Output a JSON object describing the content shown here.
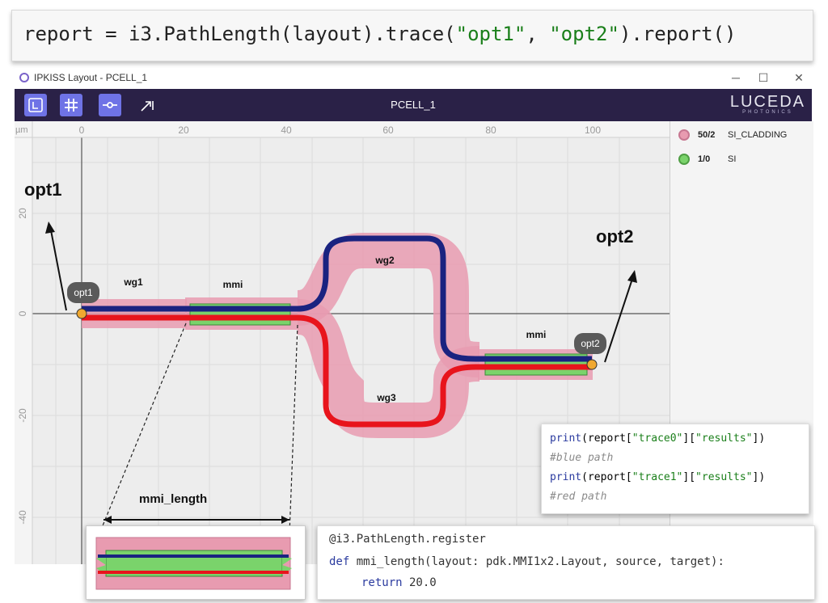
{
  "code_line": {
    "prefix": "report = i3.PathLength(layout).trace(",
    "arg1": "\"opt1\"",
    "sep": ", ",
    "arg2": "\"opt2\"",
    "suffix": ").report()"
  },
  "window": {
    "title": "IPKISS Layout - PCELL_1",
    "minimize": "─",
    "maximize": "☐",
    "close": "✕"
  },
  "toolbar": {
    "cell_name": "PCELL_1",
    "brand": "LUCEDA",
    "brand_sub": "PHOTONICS",
    "buttons": [
      "layer-view-button",
      "grid-button",
      "ports-button",
      "measure-button"
    ]
  },
  "axes": {
    "unit": "µm",
    "x_ticks": [
      "0",
      "20",
      "40",
      "60",
      "80",
      "100"
    ],
    "y_ticks": [
      "20",
      "0",
      "-20",
      "-40"
    ]
  },
  "layers": [
    {
      "num": "50/2",
      "name": "SI_CLADDING",
      "color": "#e89bb0"
    },
    {
      "num": "1/0",
      "name": "SI",
      "color": "#7ad36b"
    }
  ],
  "layout_labels": {
    "wg1": "wg1",
    "mmi_left": "mmi",
    "wg2": "wg2",
    "wg3": "wg3",
    "mmi_right": "mmi",
    "port1": "opt1",
    "port2": "opt2"
  },
  "callouts": {
    "opt1": "opt1",
    "opt2": "opt2",
    "mmi_length": "mmi_length"
  },
  "print_code": {
    "line1": {
      "fn": "print",
      "a": "(report[",
      "s1": "\"trace0\"",
      "b": "][",
      "s2": "\"results\"",
      "c": "])"
    },
    "line2": "#blue path",
    "line3": {
      "fn": "print",
      "a": "(report[",
      "s1": "\"trace1\"",
      "b": "][",
      "s2": "\"results\"",
      "c": "])"
    },
    "line4": "#red path"
  },
  "def_code": {
    "decorator": "@i3.PathLength.register",
    "def_kw": "def",
    "signature": " mmi_length(layout: pdk.MMI1x2.Layout, source, target):",
    "return_kw": "return",
    "return_val": " 20.0"
  },
  "colors": {
    "cladding": "#e89bb0",
    "core": "#7ad36b",
    "blue_path": "#1a2380",
    "red_path": "#e8141c",
    "toolbar_bg": "#2a2147",
    "port": "#f0a830"
  }
}
